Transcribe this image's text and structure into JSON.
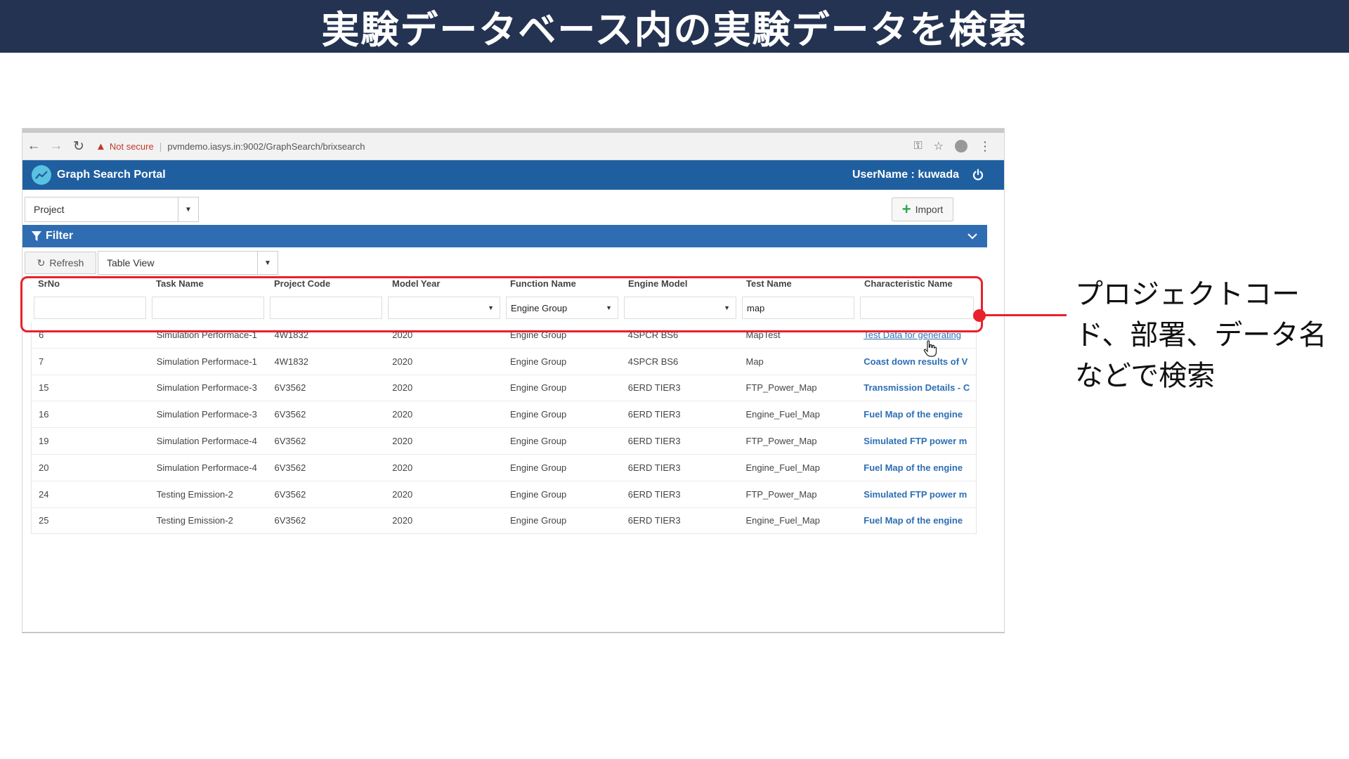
{
  "slide": {
    "title": "実験データベース内の実験データを検索",
    "annotation": "プロジェクトコード、部署、データ名などで検索"
  },
  "browser": {
    "not_secure": "Not secure",
    "url": "pvmdemo.iasys.in:9002/GraphSearch/brixsearch"
  },
  "app": {
    "title": "Graph Search Portal",
    "user_label": "UserName : kuwada"
  },
  "toolbar": {
    "project_select": "Project",
    "import_label": "Import",
    "filter_label": "Filter",
    "refresh_label": "Refresh",
    "view_select": "Table View"
  },
  "table": {
    "columns": [
      "SrNo",
      "Task Name",
      "Project Code",
      "Model Year",
      "Function Name",
      "Engine Model",
      "Test Name",
      "Characteristic Name"
    ],
    "filters": [
      "",
      "",
      "",
      "",
      "Engine Group",
      "",
      "map",
      ""
    ],
    "rows": [
      [
        "6",
        "Simulation Performace-1",
        "4W1832",
        "2020",
        "Engine Group",
        "4SPCR BS6",
        "MapTest",
        "Test Data for generating"
      ],
      [
        "7",
        "Simulation Performace-1",
        "4W1832",
        "2020",
        "Engine Group",
        "4SPCR BS6",
        "Map",
        "Coast down results of V"
      ],
      [
        "15",
        "Simulation Performace-3",
        "6V3562",
        "2020",
        "Engine Group",
        "6ERD TIER3",
        "FTP_Power_Map",
        "Transmission Details - C"
      ],
      [
        "16",
        "Simulation Performace-3",
        "6V3562",
        "2020",
        "Engine Group",
        "6ERD TIER3",
        "Engine_Fuel_Map",
        "Fuel Map of the engine"
      ],
      [
        "19",
        "Simulation Performace-4",
        "6V3562",
        "2020",
        "Engine Group",
        "6ERD TIER3",
        "FTP_Power_Map",
        "Simulated FTP power m"
      ],
      [
        "20",
        "Simulation Performace-4",
        "6V3562",
        "2020",
        "Engine Group",
        "6ERD TIER3",
        "Engine_Fuel_Map",
        "Fuel Map of the engine"
      ],
      [
        "24",
        "Testing Emission-2",
        "6V3562",
        "2020",
        "Engine Group",
        "6ERD TIER3",
        "FTP_Power_Map",
        "Simulated FTP power m"
      ],
      [
        "25",
        "Testing Emission-2",
        "6V3562",
        "2020",
        "Engine Group",
        "6ERD TIER3",
        "Engine_Fuel_Map",
        "Fuel Map of the engine"
      ]
    ]
  },
  "colors": {
    "slide_header": "#243352",
    "app_bar": "#1f5fa0",
    "filter_bar": "#2f6db3",
    "highlight": "#e8212b",
    "link": "#2d6fb5"
  }
}
